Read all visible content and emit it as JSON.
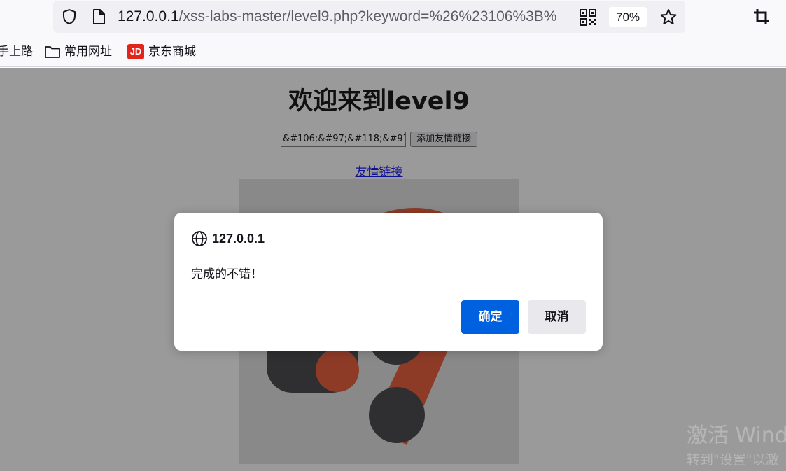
{
  "browser": {
    "url_host": "127.0.0.1",
    "url_rest": "/xss-labs-master/level9.php?keyword=%26%23106%3B%",
    "zoom": "70%",
    "icons": [
      "shield-icon",
      "page-icon",
      "qr-code-icon",
      "star-icon",
      "crop-icon"
    ]
  },
  "bookmarks": {
    "items": [
      {
        "label": "手上路"
      },
      {
        "label": "常用网址",
        "icon": "folder-icon"
      },
      {
        "label": "京东商城",
        "icon": "jd-logo",
        "badge": "JD"
      }
    ]
  },
  "page": {
    "title": "欢迎来到level9",
    "keyword_input_value": "&#106;&#97;&#118;&#97",
    "add_button_label": "添加友情链接",
    "friend_link_label": "友情链接"
  },
  "dialog": {
    "host": "127.0.0.1",
    "message": "完成的不错！",
    "confirm_label": "确定",
    "cancel_label": "取消"
  },
  "watermark": {
    "line1": "激活 Wind",
    "line2": "转到\"设置\"以激"
  },
  "colors": {
    "primary_button": "#0061e0",
    "jd_red": "#e1251b",
    "logo_orange": "#e8512a",
    "logo_dark": "#3a3a3d"
  }
}
